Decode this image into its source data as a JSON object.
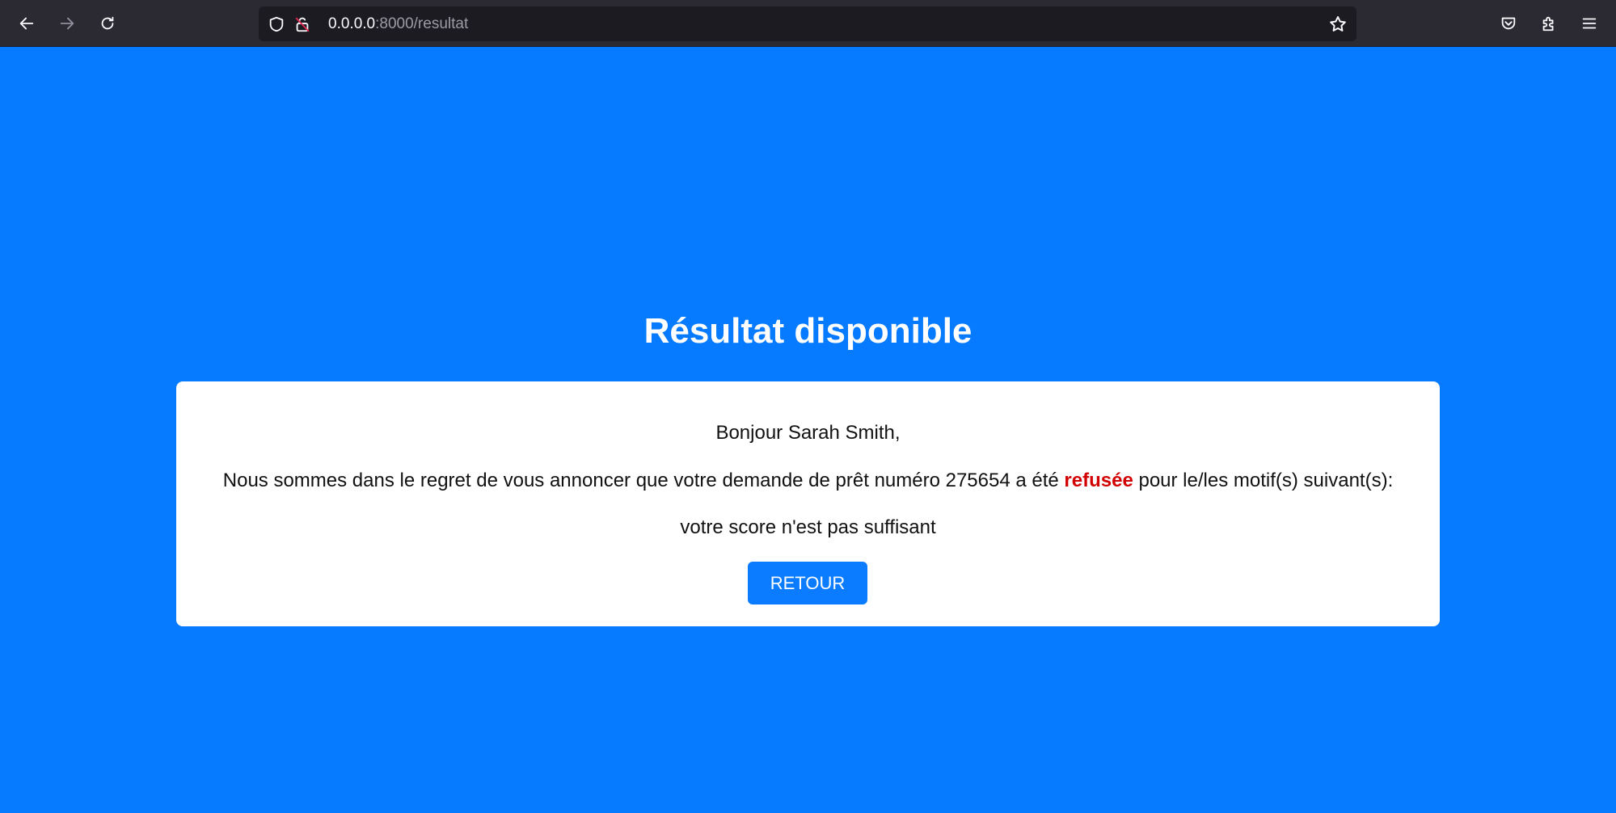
{
  "browser": {
    "url_host": "0.0.0.0",
    "url_path": ":8000/resultat",
    "icons": {
      "back": "arrow-left-icon",
      "forward": "arrow-right-icon",
      "reload": "reload-icon",
      "shield": "shield-icon",
      "insecure_lock": "lock-slash-icon",
      "bookmark": "star-icon",
      "pocket": "pocket-icon",
      "extensions": "puzzle-icon",
      "menu": "hamburger-menu-icon"
    }
  },
  "page": {
    "title": "Résultat disponible",
    "greeting": "Bonjour Sarah Smith,",
    "message_before": "Nous sommes dans le regret de vous annoncer que votre demande de prêt numéro 275654 a été ",
    "message_status": "refusée",
    "message_after": " pour le/les motif(s) suivant(s):",
    "reason": "votre score n'est pas suffisant",
    "button_label": "RETOUR"
  },
  "colors": {
    "background": "#077bff",
    "status_refused": "#d20000",
    "button": "#0b7cff"
  }
}
